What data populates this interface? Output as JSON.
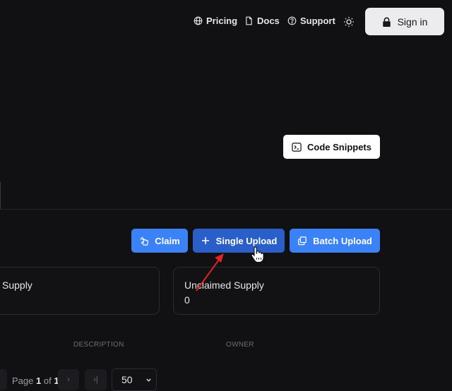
{
  "nav": {
    "pricing": "Pricing",
    "docs": "Docs",
    "support": "Support",
    "sign_in": "Sign in"
  },
  "actions": {
    "code_snippets": "Code Snippets",
    "claim": "Claim",
    "single_upload": "Single Upload",
    "batch_upload": "Batch Upload"
  },
  "stats": [
    {
      "label": "Supply",
      "value": ""
    },
    {
      "label": "Unclaimed Supply",
      "value": "0"
    }
  ],
  "table": {
    "columns": [
      "DESCRIPTION",
      "OWNER"
    ]
  },
  "pagination": {
    "page_prefix": "Page",
    "current": "1",
    "of": "of",
    "total": "1",
    "next": "›",
    "last": "›|",
    "page_size": "50"
  },
  "colors": {
    "background": "#111113",
    "accent": "#3b82f6",
    "accent_active": "#2a5fc9",
    "annotation_arrow": "#e02424"
  }
}
